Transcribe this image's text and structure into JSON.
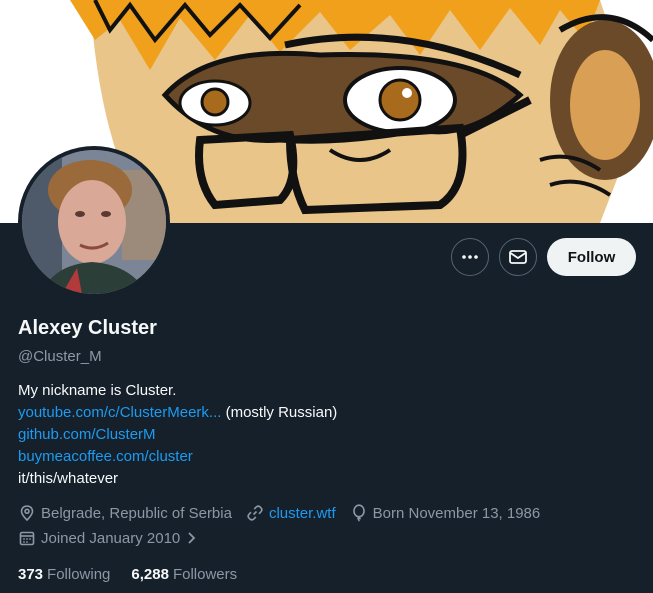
{
  "header": {
    "follow_label": "Follow",
    "more_icon": "more-horizontal-icon",
    "message_icon": "envelope-icon"
  },
  "profile": {
    "name": "Alexey Cluster",
    "handle": "@Cluster_M",
    "bio": {
      "line1": "My nickname is Cluster.",
      "link_youtube": "youtube.com/c/ClusterMeerk...",
      "youtube_suffix": " (mostly Russian)",
      "link_github": "github.com/ClusterM",
      "link_coffee": "buymeacoffee.com/cluster",
      "line5": "it/this/whatever"
    },
    "location": "Belgrade, Republic of Serbia",
    "website": "cluster.wtf",
    "birthday": "Born November 13, 1986",
    "joined": "Joined January 2010"
  },
  "stats": {
    "following_count": "373",
    "following_label": "Following",
    "followers_count": "6,288",
    "followers_label": "Followers"
  },
  "colors": {
    "background": "#15202b",
    "link": "#1d9bf0",
    "secondary_text": "#8b98a5",
    "follow_button": "#eff3f4"
  }
}
